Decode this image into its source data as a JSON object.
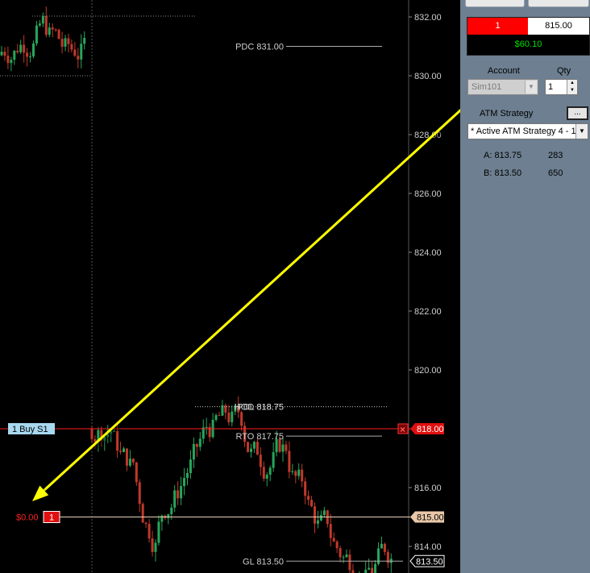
{
  "chart": {
    "price_axis": {
      "ticks": [
        "832.00",
        "830.00",
        "828.00",
        "826.00",
        "824.00",
        "822.00",
        "820.00",
        "818.00",
        "816.00",
        "815.00",
        "814.00",
        "813.50"
      ],
      "current_price": "815.00",
      "last_price": "813.50"
    },
    "levels": [
      {
        "name": "PDC",
        "label": "PDC 831.00",
        "price": 831.0
      },
      {
        "name": "HOD",
        "label": "HOD 818.75",
        "price": 818.75
      },
      {
        "name": "PDL",
        "label": "PDL 818.75",
        "price": 818.75
      },
      {
        "name": "RTO",
        "label": "RTO 817.75",
        "price": 817.75
      },
      {
        "name": "GL",
        "label": "GL 813.50",
        "price": 813.5
      }
    ],
    "order": {
      "label": "1  Buy S1",
      "price": 818.0,
      "price_tag": "818.00",
      "cancel_icon": "close-icon"
    },
    "position": {
      "pnl": "$0.00",
      "qty": "1",
      "price": 815.0,
      "price_tag": "815.00"
    },
    "annotation": {
      "type": "double-arrow",
      "color": "#ffff00"
    },
    "colors": {
      "up_bar": "#26a65b",
      "down_bar": "#c0392b",
      "order_line": "#ff2020",
      "position_line": "#e8d0b8",
      "axis_text": "#cfcfcf"
    }
  },
  "order_panel": {
    "position_qty": "1",
    "position_avg_price": "815.00",
    "unrealized_pnl": "$60.10",
    "account_label": "Account",
    "account_value": "Sim101",
    "qty_label": "Qty",
    "qty_value": "1",
    "atm_label": "ATM Strategy",
    "atm_button": "...",
    "atm_value": "* Active ATM Strategy 4 - 1",
    "ask": {
      "label": "A: 813.75",
      "size": "283"
    },
    "bid": {
      "label": "B: 813.50",
      "size": "650"
    }
  }
}
